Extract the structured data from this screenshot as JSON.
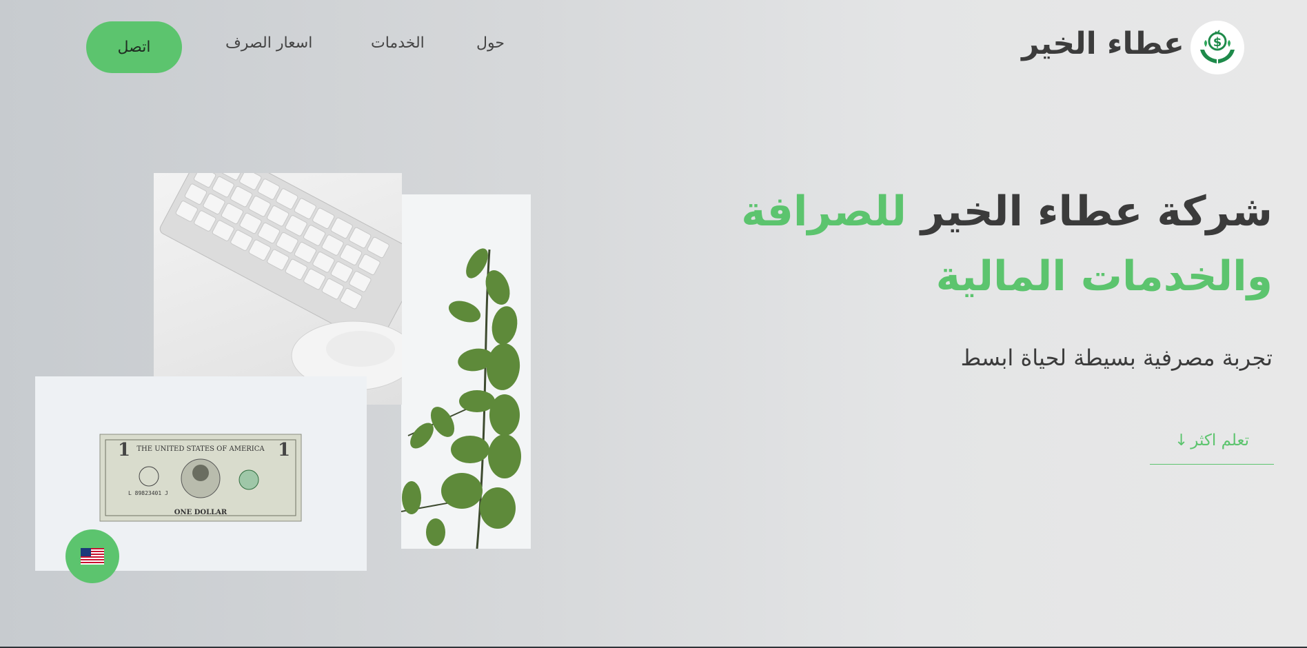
{
  "header": {
    "brand_name": "عطاء الخير",
    "nav": {
      "about": "حول",
      "services": "الخدمات",
      "rates": "اسعار الصرف",
      "contact": "اتصل"
    }
  },
  "hero": {
    "title_dark": "شركة عطاء الخير",
    "title_green_1": "للصرافة",
    "title_green_2": "والخدمات المالية",
    "subtitle": "تجربة مصرفية بسيطة لحياة ابسط",
    "learn_more": "تعلم اكثر",
    "learn_more_arrow": "↓"
  },
  "dollar_bill": {
    "top_text": "THE UNITED STATES OF AMERICA",
    "bottom_text": "ONE DOLLAR",
    "serial": "L 89823401 J",
    "denomination": "1"
  },
  "colors": {
    "accent": "#5cc46e",
    "text_dark": "#3b3b3b"
  },
  "icons": {
    "logo": "hands-dollar-icon",
    "language": "us-flag-icon"
  }
}
